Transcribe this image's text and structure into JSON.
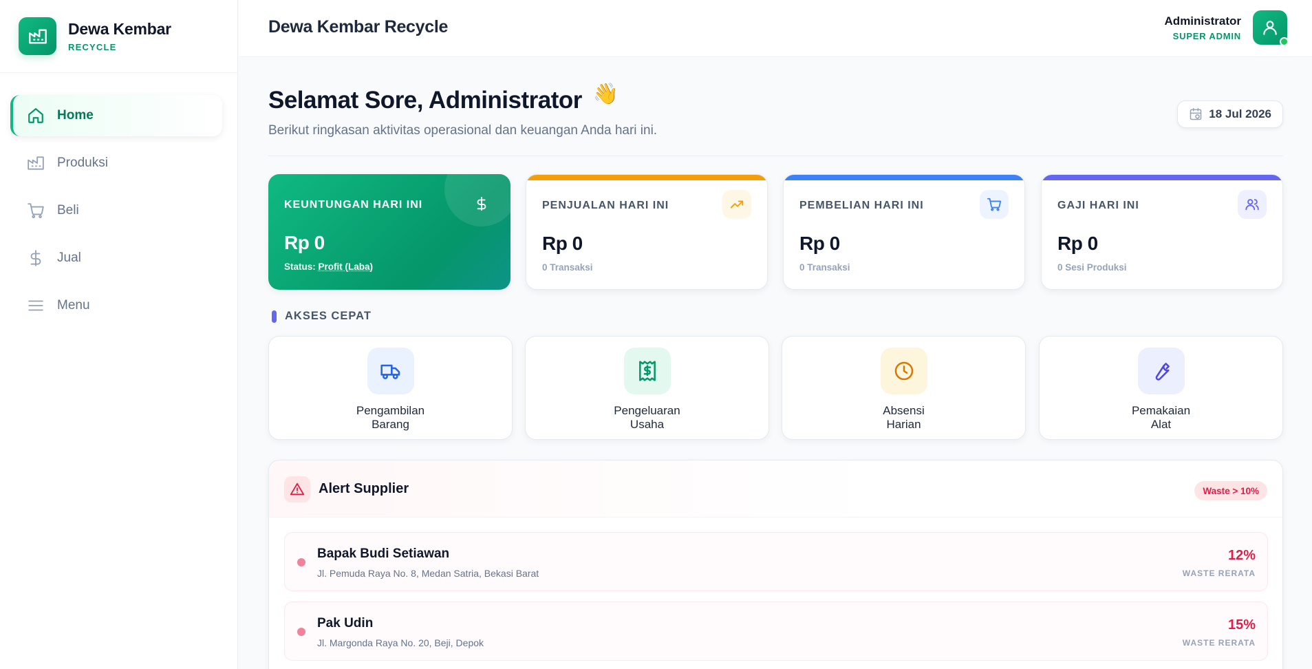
{
  "brand": {
    "name": "Dewa Kembar",
    "sub": "RECYCLE"
  },
  "sidebar": {
    "items": [
      {
        "label": "Home",
        "icon": "home-icon",
        "active": true
      },
      {
        "label": "Produksi",
        "icon": "factory-icon"
      },
      {
        "label": "Beli",
        "icon": "cart-icon"
      },
      {
        "label": "Jual",
        "icon": "dollar-icon"
      },
      {
        "label": "Menu",
        "icon": "menu-icon"
      }
    ]
  },
  "topbar": {
    "title": "Dewa Kembar Recycle",
    "user_name": "Administrator",
    "user_role": "SUPER ADMIN"
  },
  "greeting": {
    "title": "Selamat Sore, Administrator",
    "emoji": "👋",
    "subtitle": "Berikut ringkasan aktivitas operasional dan keuangan Anda hari ini.",
    "date": "18 Jul 2026"
  },
  "stats": [
    {
      "label": "KEUNTUNGAN HARI INI",
      "value": "Rp 0",
      "status_prefix": "Status:",
      "status_value": "Profit (Laba)",
      "accent": "#10b981"
    },
    {
      "label": "PENJUALAN HARI INI",
      "value": "Rp 0",
      "sub": "0 Transaksi",
      "accent": "#f59e0b"
    },
    {
      "label": "PEMBELIAN HARI INI",
      "value": "Rp 0",
      "sub": "0 Transaksi",
      "accent": "#3b82f6"
    },
    {
      "label": "GAJI HARI INI",
      "value": "Rp 0",
      "sub": "0 Sesi Produksi",
      "accent": "#6366f1"
    }
  ],
  "quick_access": {
    "title": "AKSES CEPAT",
    "items": [
      {
        "line1": "Pengambilan",
        "line2": "Barang",
        "icon": "truck-icon"
      },
      {
        "line1": "Pengeluaran",
        "line2": "Usaha",
        "icon": "receipt-icon"
      },
      {
        "line1": "Absensi",
        "line2": "Harian",
        "icon": "clock-icon"
      },
      {
        "line1": "Pemakaian",
        "line2": "Alat",
        "icon": "wrench-icon"
      }
    ]
  },
  "alert": {
    "title": "Alert Supplier",
    "badge": "Waste > 10%",
    "suppliers": [
      {
        "name": "Bapak Budi Setiawan",
        "address": "Jl. Pemuda Raya No. 8, Medan Satria, Bekasi Barat",
        "pct": "12%",
        "pct_label": "WASTE RERATA"
      },
      {
        "name": "Pak Udin",
        "address": "Jl. Margonda Raya No. 20, Beji, Depok",
        "pct": "15%",
        "pct_label": "WASTE RERATA"
      }
    ]
  },
  "colors": {
    "primary": "#10b981",
    "danger": "#e11d48",
    "indigo": "#6366f1"
  }
}
